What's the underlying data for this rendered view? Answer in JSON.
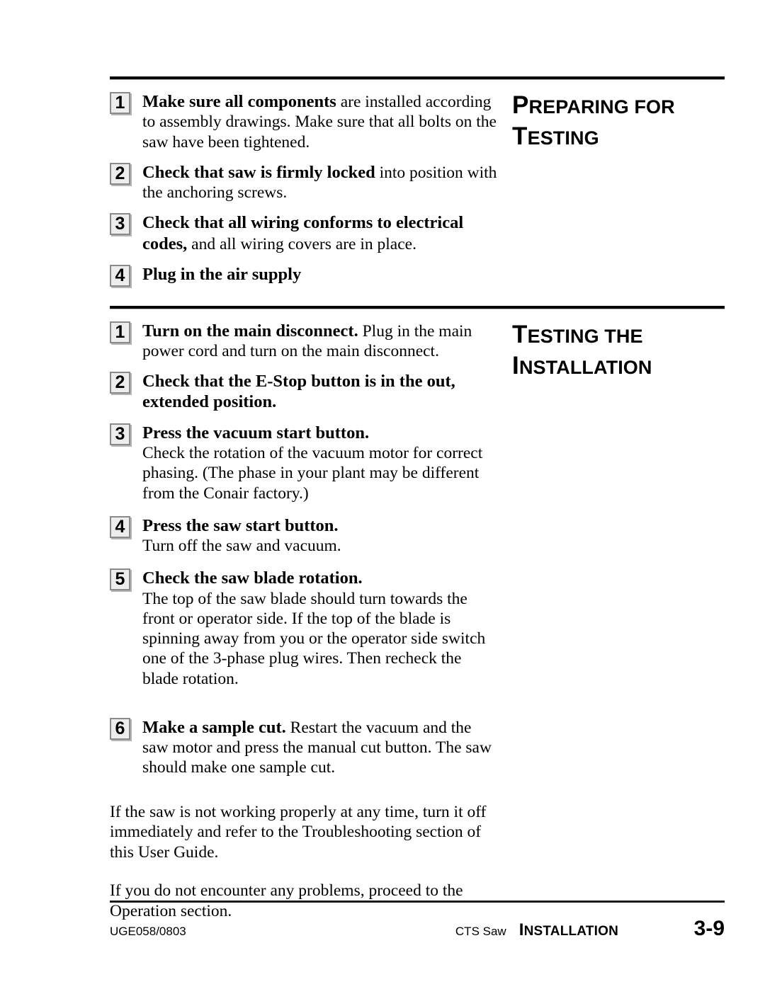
{
  "sections": [
    {
      "heading": {
        "line1_initial": "P",
        "line1_rest": "REPARING FOR",
        "line2_initial": "T",
        "line2_rest": "ESTING"
      },
      "steps": [
        {
          "num": "1",
          "bold": "Make sure all components",
          "rest": " are installed according to assembly drawings. Make sure that all bolts on the saw have been tightened."
        },
        {
          "num": "2",
          "bold": "Check that saw is firmly locked",
          "rest": " into position with the anchoring screws."
        },
        {
          "num": "3",
          "bold": " Check that all wiring conforms to electrical codes,",
          "rest": " and all wiring covers are in place."
        },
        {
          "num": "4",
          "bold": "Plug in the air supply",
          "rest": ""
        }
      ]
    },
    {
      "heading": {
        "line1_initial": "T",
        "line1_rest": "ESTING THE",
        "line2_initial": "I",
        "line2_rest": "NSTALLATION"
      },
      "steps": [
        {
          "num": "1",
          "bold": "Turn on the main disconnect.",
          "rest": " Plug in the main power cord and turn on the main disconnect."
        },
        {
          "num": "2",
          "bold": "Check that the E-Stop button is in the out, extended position.",
          "rest": ""
        },
        {
          "num": "3",
          "bold": "Press the vacuum start button.",
          "rest": "Check the rotation of the vacuum motor for correct phasing. (The phase in your plant may be different from the Conair factory.)"
        },
        {
          "num": "4",
          "bold": "Press the saw start button.",
          "rest": "Turn off the saw and vacuum."
        },
        {
          "num": "5",
          "bold": "Check the saw blade rotation.",
          "rest": "The top of the saw blade should turn towards the front or operator side. If the top of the blade is spinning away from you or the operator side switch one of the 3-phase plug wires. Then recheck the blade rotation."
        },
        {
          "num": "6",
          "bold": "Make a sample cut.",
          "rest": " Restart the vacuum and the saw motor and press the manual cut button. The saw should make one sample cut."
        }
      ],
      "closing_paragraphs": [
        "If the saw is not working properly at any time, turn it off immediately and refer to the Troubleshooting section of this User Guide.",
        "If you do not encounter any problems, proceed to the Operation section."
      ]
    }
  ],
  "footer": {
    "document_code": "UGE058/0803",
    "product": "CTS Saw",
    "section_initial": "I",
    "section_rest": "NSTALLATION",
    "page_number": "3-9"
  }
}
